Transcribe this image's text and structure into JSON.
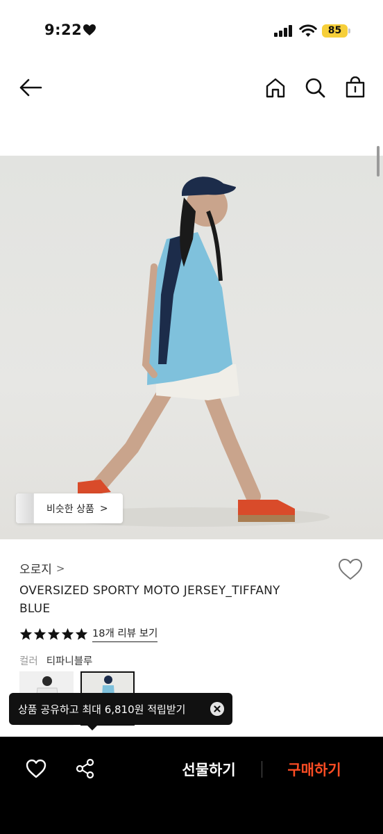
{
  "status_bar": {
    "time": "9:22",
    "battery": "85"
  },
  "nav": {
    "back": "back-arrow-icon",
    "home": "home-icon",
    "search": "search-icon",
    "bag": "shopping-bag-icon"
  },
  "image": {
    "similar_label": "비슷한 상품",
    "similar_chevron": ">"
  },
  "product": {
    "brand": "오로지",
    "brand_chevron": ">",
    "title": "OVERSIZED SPORTY MOTO JERSEY_TIFFANY BLUE",
    "rating_stars": 5,
    "review_link": "18개 리뷰 보기",
    "color_label": "컬러",
    "color_value": "티파니블루"
  },
  "tooltip": {
    "text": "상품 공유하고 최대 6,810원 적립받기"
  },
  "bottom_bar": {
    "gift": "선물하기",
    "buy": "구매하기"
  },
  "colors": {
    "buy_accent": "#ff4d24",
    "battery": "#f6cf3a",
    "bar_bg": "#000000"
  }
}
